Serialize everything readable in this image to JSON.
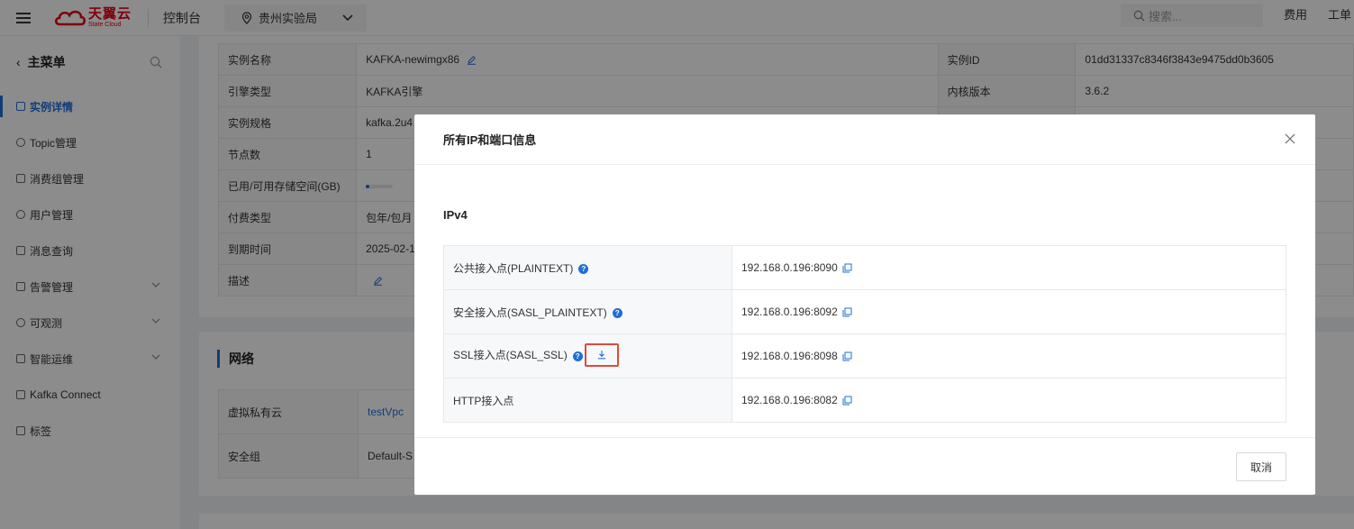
{
  "topbar": {
    "logo_cn": "天翼云",
    "logo_en": "State Cloud",
    "console": "控制台",
    "region": "贵州实验局",
    "search_placeholder": "搜索...",
    "link_fee": "费用",
    "link_ticket": "工单"
  },
  "sidebar": {
    "title": "主菜单",
    "items": [
      {
        "label": "实例详情",
        "active": true
      },
      {
        "label": "Topic管理"
      },
      {
        "label": "消费组管理"
      },
      {
        "label": "用户管理"
      },
      {
        "label": "消息查询"
      },
      {
        "label": "告警管理",
        "expandable": true
      },
      {
        "label": "可观测",
        "expandable": true
      },
      {
        "label": "智能运维",
        "expandable": true
      },
      {
        "label": "Kafka Connect"
      },
      {
        "label": "标签"
      }
    ]
  },
  "instance": {
    "rows": [
      {
        "label": "实例名称",
        "value": "KAFKA-newimgx86",
        "label2": "实例ID",
        "value2": "01dd31337c8346f3843e9475dd0b3605"
      },
      {
        "label": "引擎类型",
        "value": "KAFKA引擎",
        "label2": "内核版本",
        "value2": "3.6.2"
      },
      {
        "label": "实例规格",
        "value": "kafka.2u4"
      },
      {
        "label": "节点数",
        "value": "1"
      },
      {
        "label": "已用/可用存储空间(GB)",
        "usage": 0.1
      },
      {
        "label": "付费类型",
        "value": "包年/包月"
      },
      {
        "label": "到期时间",
        "value": "2025-02-1"
      },
      {
        "label": "描述"
      }
    ]
  },
  "network": {
    "title": "网络",
    "rows": [
      {
        "label": "虚拟私有云",
        "value": "testVpc"
      },
      {
        "label": "安全组",
        "value": "Default-S"
      }
    ]
  },
  "modal": {
    "title": "所有IP和端口信息",
    "section": "IPv4",
    "endpoints": [
      {
        "label": "公共接入点(PLAINTEXT)",
        "value": "192.168.0.196:8090",
        "help": true
      },
      {
        "label": "安全接入点(SASL_PLAINTEXT)",
        "value": "192.168.0.196:8092",
        "help": true
      },
      {
        "label": "SSL接入点(SASL_SSL)",
        "value": "192.168.0.196:8098",
        "help": true,
        "download": true
      },
      {
        "label": "HTTP接入点",
        "value": "192.168.0.196:8082"
      }
    ],
    "cancel_label": "取消"
  },
  "colors": {
    "accent": "#1e6fd9",
    "brand": "#e60012",
    "highlight": "#e04a3a"
  }
}
